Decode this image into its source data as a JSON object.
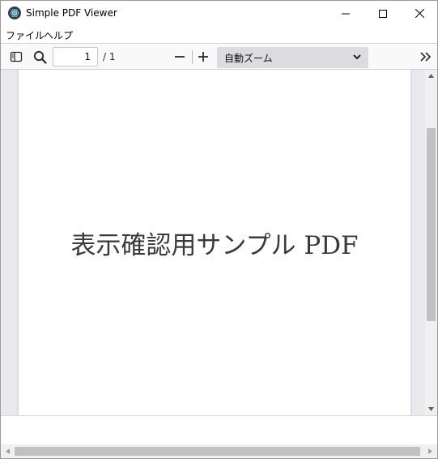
{
  "window": {
    "title": "Simple PDF Viewer",
    "app_icon": "electron-atom-icon",
    "controls": [
      "minimize-icon",
      "maximize-icon",
      "close-icon"
    ]
  },
  "menubar": {
    "items": [
      {
        "label": "ファイル"
      },
      {
        "label": "ヘルプ"
      }
    ]
  },
  "toolbar": {
    "sidebar_toggle_icon": "sidebar-toggle-icon",
    "search_icon": "search-icon",
    "page_number": "1",
    "page_count": "/ 1",
    "zoom_out_icon": "minus-icon",
    "zoom_in_icon": "plus-icon",
    "zoom_selected": "自動ズーム",
    "more_icon": "double-chevron-right-icon"
  },
  "document": {
    "text": "表示確認用サンプル PDF"
  },
  "colors": {
    "toolbar_bg": "#f9f9fa",
    "viewer_bg": "#e9e9ed",
    "zoom_select_bg": "#dcdce0",
    "scrollbar_thumb": "#c1c1c1"
  }
}
